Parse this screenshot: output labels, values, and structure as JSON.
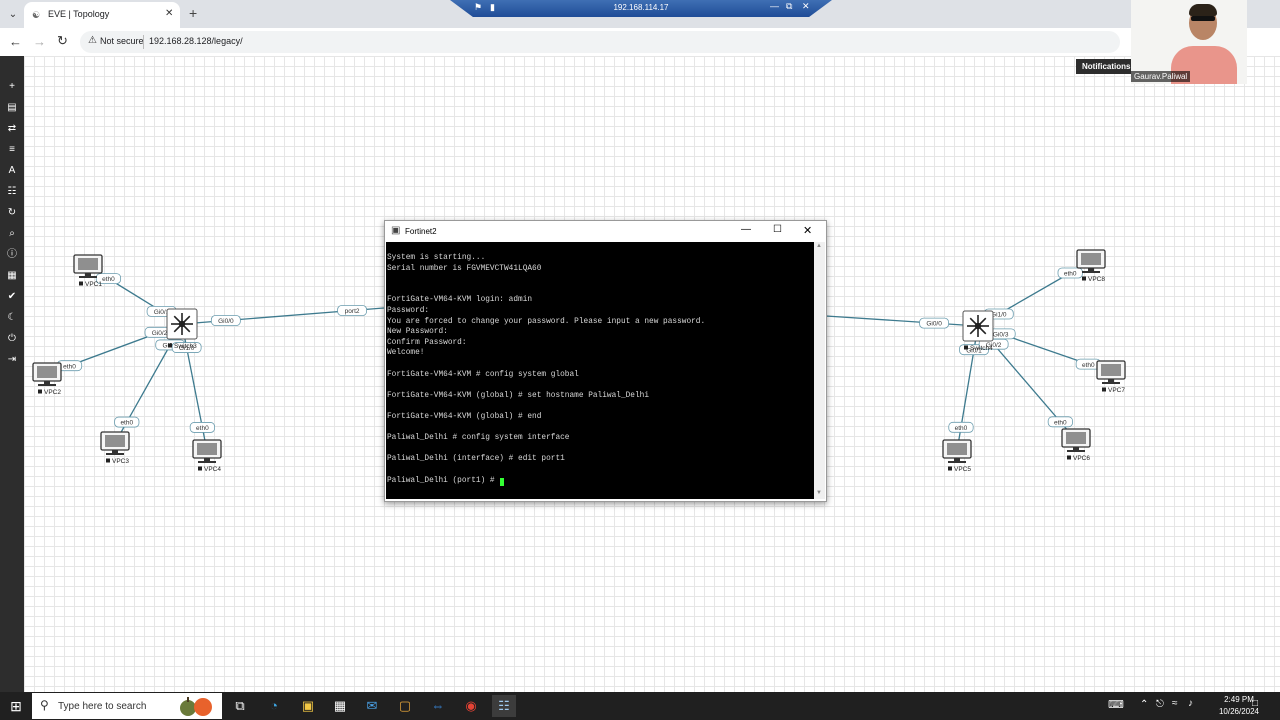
{
  "browser": {
    "tab_title": "EVE | Topology",
    "url": "192.168.28.128/legacy/",
    "security_label": "Not secure",
    "remote_ip": "192.168.114.17"
  },
  "overlay": {
    "notifications_label": "Notifications",
    "webcam_name": "Gaurav.Paliwal"
  },
  "sidebar_icons": [
    "add-icon",
    "layers-icon",
    "transfer-icon",
    "list-icon",
    "text-icon",
    "grid-icon",
    "refresh-icon",
    "zoom-icon",
    "info-icon",
    "notes-icon",
    "check-icon",
    "moon-icon",
    "power-icon",
    "logout-icon"
  ],
  "topology": {
    "nodes": [
      {
        "id": "VPC1",
        "label": "VPC1",
        "type": "vpc"
      },
      {
        "id": "VPC2",
        "label": "VPC2",
        "type": "vpc"
      },
      {
        "id": "VPC3",
        "label": "VPC3",
        "type": "vpc"
      },
      {
        "id": "VPC4",
        "label": "VPC4",
        "type": "vpc"
      },
      {
        "id": "Switch3",
        "label": "Switch3",
        "type": "switch"
      },
      {
        "id": "Switch4",
        "label": "Switch4",
        "type": "switch"
      },
      {
        "id": "VPC5",
        "label": "VPC5",
        "type": "vpc"
      },
      {
        "id": "VPC6",
        "label": "VPC6",
        "type": "vpc"
      },
      {
        "id": "VPC7",
        "label": "VPC7",
        "type": "vpc"
      },
      {
        "id": "VPC8",
        "label": "VPC8",
        "type": "vpc"
      }
    ],
    "links": [
      {
        "a": "VPC1",
        "b": "Switch3",
        "a_port": "eth0",
        "b_port": "Gi0/1"
      },
      {
        "a": "VPC2",
        "b": "Switch3",
        "a_port": "eth0",
        "b_port": "Gi0/2"
      },
      {
        "a": "VPC3",
        "b": "Switch3",
        "a_port": "eth0",
        "b_port": "Gi0/3"
      },
      {
        "a": "VPC4",
        "b": "Switch3",
        "a_port": "eth0",
        "b_port": "Gi1/0"
      },
      {
        "a": "Switch3",
        "b": "Fortinet2",
        "a_port": "Gi0/0",
        "b_port": "port2"
      },
      {
        "a": "Switch4",
        "b": "Fortinet2",
        "a_port": "Gi0/0",
        "b_port": ""
      },
      {
        "a": "VPC8",
        "b": "Switch4",
        "a_port": "eth0",
        "b_port": "Gi1/0"
      },
      {
        "a": "VPC7",
        "b": "Switch4",
        "a_port": "eth0",
        "b_port": "Gi0/3"
      },
      {
        "a": "VPC5",
        "b": "Switch4",
        "a_port": "eth0",
        "b_port": "Gi0/1"
      },
      {
        "a": "VPC6",
        "b": "Switch4",
        "a_port": "eth0",
        "b_port": "Gi0/2"
      }
    ]
  },
  "terminal": {
    "title": "Fortinet2",
    "lines": [
      "System is starting...",
      "Serial number is FGVMEVCTW41LQA60",
      "",
      "",
      "FortiGate-VM64-KVM login: admin",
      "Password:",
      "You are forced to change your password. Please input a new password.",
      "New Password:",
      "Confirm Password:",
      "Welcome!",
      "",
      "FortiGate-VM64-KVM # config system global",
      "",
      "FortiGate-VM64-KVM (global) # set hostname Paliwal_Delhi",
      "",
      "FortiGate-VM64-KVM (global) # end",
      "",
      "Paliwal_Delhi # config system interface",
      "",
      "Paliwal_Delhi (interface) # edit port1",
      "",
      "Paliwal_Delhi (port1) # "
    ]
  },
  "taskbar": {
    "search_placeholder": "Type here to search",
    "time": "2:49 PM",
    "date": "10/26/2024",
    "apps": [
      "task-view-icon",
      "edge-icon",
      "file-explorer-icon",
      "store-icon",
      "mail-icon",
      "app-icon",
      "teamviewer-icon",
      "chrome-icon",
      "network-app-icon"
    ]
  }
}
